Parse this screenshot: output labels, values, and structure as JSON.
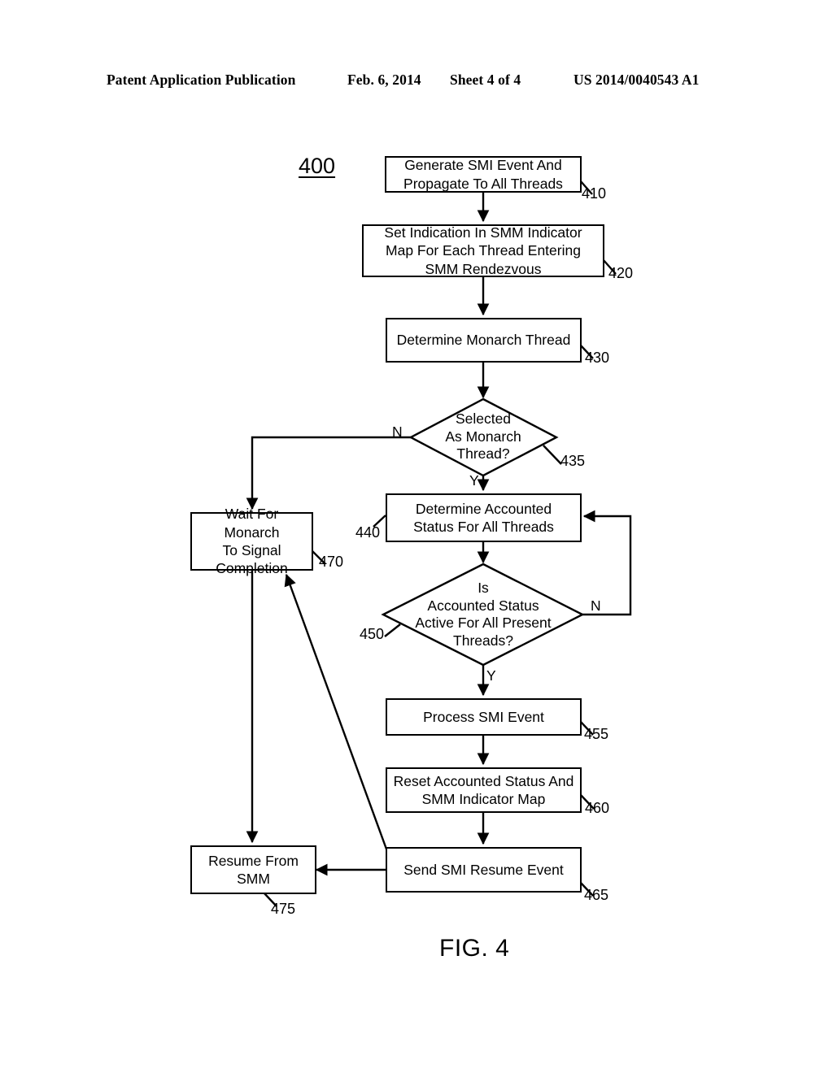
{
  "header": {
    "publication": "Patent Application Publication",
    "date": "Feb. 6, 2014",
    "sheet": "Sheet 4 of 4",
    "patent_number": "US 2014/0040543 A1"
  },
  "figure": {
    "label": "FIG. 4",
    "diagram_id": "400"
  },
  "nodes": [
    {
      "ref": "410",
      "type": "process",
      "text": "Generate SMI Event And\nPropagate To All Threads"
    },
    {
      "ref": "420",
      "type": "process",
      "text": "Set Indication In SMM Indicator\nMap For Each Thread Entering\nSMM Rendezvous"
    },
    {
      "ref": "430",
      "type": "process",
      "text": "Determine Monarch Thread"
    },
    {
      "ref": "435",
      "type": "decision",
      "text": "Selected\nAs Monarch\nThread?"
    },
    {
      "ref": "440",
      "type": "process",
      "text": "Determine Accounted\nStatus For All Threads"
    },
    {
      "ref": "450",
      "type": "decision",
      "text": "Is\nAccounted Status\nActive For All Present\nThreads?"
    },
    {
      "ref": "455",
      "type": "process",
      "text": "Process SMI Event"
    },
    {
      "ref": "460",
      "type": "process",
      "text": "Reset Accounted Status And\nSMM Indicator Map"
    },
    {
      "ref": "465",
      "type": "process",
      "text": "Send SMI Resume Event"
    },
    {
      "ref": "470",
      "type": "process",
      "text": "Wait For Monarch\nTo Signal\nCompletion"
    },
    {
      "ref": "475",
      "type": "process",
      "text": "Resume From\nSMM"
    }
  ],
  "branch_labels": {
    "d435_no": "N",
    "d435_yes": "Y",
    "d450_no": "N",
    "d450_yes": "Y"
  },
  "colors": {
    "ink": "#000000",
    "paper": "#ffffff"
  }
}
